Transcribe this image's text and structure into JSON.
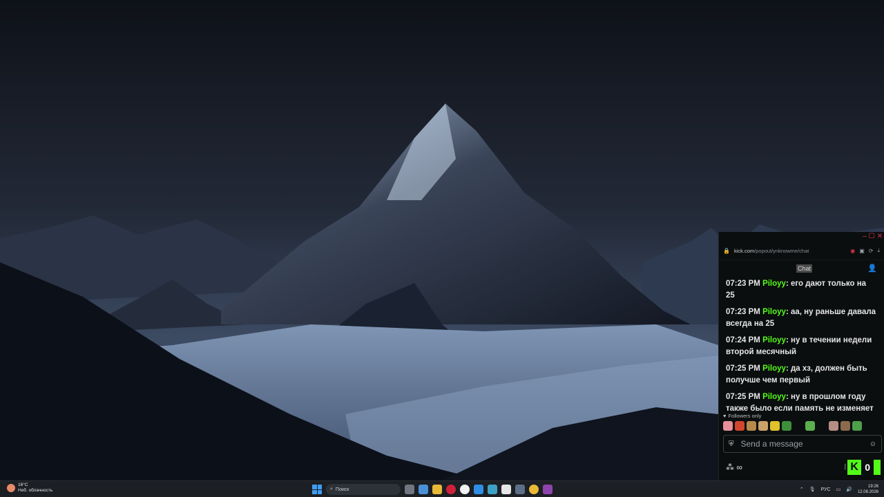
{
  "browser": {
    "url_domain": "kick.com",
    "url_path": "/popout/ynknowme/chat"
  },
  "chat": {
    "title": "Chat",
    "messages": [
      {
        "time": "07:23 PM",
        "user": "Piloyy",
        "text": "его дают только на 25"
      },
      {
        "time": "07:23 PM",
        "user": "Piloyy",
        "text": "аа, ну раньше давала всегда на 25"
      },
      {
        "time": "07:24 PM",
        "user": "Piloyy",
        "text": "ну в течении недели второй месячный"
      },
      {
        "time": "07:25 PM",
        "user": "Piloyy",
        "text": "да хз, должен быть получше чем первый"
      },
      {
        "time": "07:25 PM",
        "user": "Piloyy",
        "text": "ну в прошлом году также было если память не изменяет"
      }
    ],
    "followers_only_label": "Followers only",
    "input_placeholder": "Send a message",
    "points_label": "∞",
    "kick_badge_letter": "K",
    "kick_count": "0"
  },
  "taskbar": {
    "weather_temp": "16°C",
    "weather_desc": "Неб. облачность",
    "search_placeholder": "Поиск",
    "language": "РУС",
    "time": "19:26",
    "date": "12.08.2026"
  },
  "colors": {
    "kick_green": "#53fc18",
    "chat_bg": "#0b0e0f",
    "taskbar_bg": "#1c1f24",
    "window_controls": "#e0344a"
  }
}
